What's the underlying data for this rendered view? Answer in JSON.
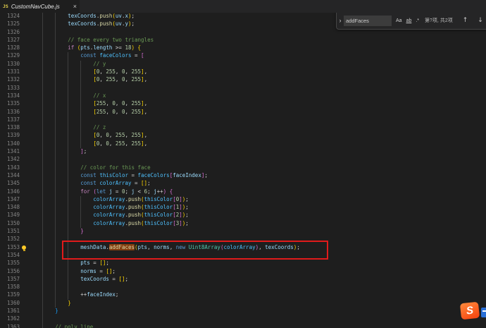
{
  "tab": {
    "icon_label": "JS",
    "filename": "CustomNavCube.js",
    "close_glyph": "×"
  },
  "find": {
    "toggle_glyph": "›",
    "query": "addFaces",
    "match_case_label": "Aa",
    "whole_word_label": "ab",
    "regex_label": ".*",
    "results": "第?项, 共2项",
    "prev_glyph": "↑",
    "next_glyph": "↓"
  },
  "watermark": {
    "letter": "S"
  },
  "colors": {
    "editor_bg": "#1e1e1e",
    "tabbar_bg": "#252526",
    "annotation_red": "#e01b1b",
    "find_match_highlight": "#ea5c00"
  },
  "editor": {
    "first_line": 1324,
    "lines": [
      {
        "n": 1324,
        "i": 12,
        "t": [
          [
            "texCoords",
            "v"
          ],
          [
            ".",
            "o"
          ],
          [
            "push",
            "f"
          ],
          [
            "(",
            "bg"
          ],
          [
            "uv",
            "v"
          ],
          [
            ".",
            "o"
          ],
          [
            "x",
            "v"
          ],
          [
            ")",
            "bg"
          ],
          [
            ";",
            "o"
          ]
        ]
      },
      {
        "n": 1325,
        "i": 12,
        "t": [
          [
            "texCoords",
            "v"
          ],
          [
            ".",
            "o"
          ],
          [
            "push",
            "f"
          ],
          [
            "(",
            "bg"
          ],
          [
            "uv",
            "v"
          ],
          [
            ".",
            "o"
          ],
          [
            "y",
            "v"
          ],
          [
            ")",
            "bg"
          ],
          [
            ";",
            "o"
          ]
        ]
      },
      {
        "n": 1326,
        "i": 0,
        "t": []
      },
      {
        "n": 1327,
        "i": 12,
        "t": [
          [
            "// face every two triangles",
            "cm"
          ]
        ]
      },
      {
        "n": 1328,
        "i": 12,
        "t": [
          [
            "if",
            "ct"
          ],
          [
            " ",
            "p"
          ],
          [
            "(",
            "bg"
          ],
          [
            "pts",
            "v"
          ],
          [
            ".",
            "o"
          ],
          [
            "length",
            "v"
          ],
          [
            " >= ",
            "o"
          ],
          [
            "18",
            "n"
          ],
          [
            ")",
            "bg"
          ],
          [
            " ",
            "p"
          ],
          [
            "{",
            "bg"
          ]
        ]
      },
      {
        "n": 1329,
        "i": 16,
        "t": [
          [
            "const",
            "k"
          ],
          [
            " ",
            "p"
          ],
          [
            "faceColors",
            "cv"
          ],
          [
            " = ",
            "o"
          ],
          [
            "[",
            "bp"
          ]
        ]
      },
      {
        "n": 1330,
        "i": 20,
        "t": [
          [
            "// y",
            "cm"
          ]
        ]
      },
      {
        "n": 1331,
        "i": 20,
        "t": [
          [
            "[",
            "bg"
          ],
          [
            "0",
            "n"
          ],
          [
            ", ",
            "o"
          ],
          [
            "255",
            "n"
          ],
          [
            ", ",
            "o"
          ],
          [
            "0",
            "n"
          ],
          [
            ", ",
            "o"
          ],
          [
            "255",
            "n"
          ],
          [
            "]",
            "bg"
          ],
          [
            ",",
            "o"
          ]
        ]
      },
      {
        "n": 1332,
        "i": 20,
        "t": [
          [
            "[",
            "bg"
          ],
          [
            "0",
            "n"
          ],
          [
            ", ",
            "o"
          ],
          [
            "255",
            "n"
          ],
          [
            ", ",
            "o"
          ],
          [
            "0",
            "n"
          ],
          [
            ", ",
            "o"
          ],
          [
            "255",
            "n"
          ],
          [
            "]",
            "bg"
          ],
          [
            ",",
            "o"
          ]
        ]
      },
      {
        "n": 1333,
        "i": 0,
        "t": []
      },
      {
        "n": 1334,
        "i": 20,
        "t": [
          [
            "// x",
            "cm"
          ]
        ]
      },
      {
        "n": 1335,
        "i": 20,
        "t": [
          [
            "[",
            "bg"
          ],
          [
            "255",
            "n"
          ],
          [
            ", ",
            "o"
          ],
          [
            "0",
            "n"
          ],
          [
            ", ",
            "o"
          ],
          [
            "0",
            "n"
          ],
          [
            ", ",
            "o"
          ],
          [
            "255",
            "n"
          ],
          [
            "]",
            "bg"
          ],
          [
            ",",
            "o"
          ]
        ]
      },
      {
        "n": 1336,
        "i": 20,
        "t": [
          [
            "[",
            "bg"
          ],
          [
            "255",
            "n"
          ],
          [
            ", ",
            "o"
          ],
          [
            "0",
            "n"
          ],
          [
            ", ",
            "o"
          ],
          [
            "0",
            "n"
          ],
          [
            ", ",
            "o"
          ],
          [
            "255",
            "n"
          ],
          [
            "]",
            "bg"
          ],
          [
            ",",
            "o"
          ]
        ]
      },
      {
        "n": 1337,
        "i": 0,
        "t": []
      },
      {
        "n": 1338,
        "i": 20,
        "t": [
          [
            "// z",
            "cm"
          ]
        ]
      },
      {
        "n": 1339,
        "i": 20,
        "t": [
          [
            "[",
            "bg"
          ],
          [
            "0",
            "n"
          ],
          [
            ", ",
            "o"
          ],
          [
            "0",
            "n"
          ],
          [
            ", ",
            "o"
          ],
          [
            "255",
            "n"
          ],
          [
            ", ",
            "o"
          ],
          [
            "255",
            "n"
          ],
          [
            "]",
            "bg"
          ],
          [
            ",",
            "o"
          ]
        ]
      },
      {
        "n": 1340,
        "i": 20,
        "t": [
          [
            "[",
            "bg"
          ],
          [
            "0",
            "n"
          ],
          [
            ", ",
            "o"
          ],
          [
            "0",
            "n"
          ],
          [
            ", ",
            "o"
          ],
          [
            "255",
            "n"
          ],
          [
            ", ",
            "o"
          ],
          [
            "255",
            "n"
          ],
          [
            "]",
            "bg"
          ],
          [
            ",",
            "o"
          ]
        ]
      },
      {
        "n": 1341,
        "i": 16,
        "t": [
          [
            "]",
            "bp"
          ],
          [
            ";",
            "o"
          ]
        ]
      },
      {
        "n": 1342,
        "i": 0,
        "t": []
      },
      {
        "n": 1343,
        "i": 16,
        "t": [
          [
            "// color for this face",
            "cm"
          ]
        ]
      },
      {
        "n": 1344,
        "i": 16,
        "t": [
          [
            "const",
            "k"
          ],
          [
            " ",
            "p"
          ],
          [
            "thisColor",
            "cv"
          ],
          [
            " = ",
            "o"
          ],
          [
            "faceColors",
            "cv"
          ],
          [
            "[",
            "bp"
          ],
          [
            "faceIndex",
            "v"
          ],
          [
            "]",
            "bp"
          ],
          [
            ";",
            "o"
          ]
        ]
      },
      {
        "n": 1345,
        "i": 16,
        "t": [
          [
            "const",
            "k"
          ],
          [
            " ",
            "p"
          ],
          [
            "colorArray",
            "cv"
          ],
          [
            " = ",
            "o"
          ],
          [
            "[]",
            "bg"
          ],
          [
            ";",
            "o"
          ]
        ]
      },
      {
        "n": 1346,
        "i": 16,
        "t": [
          [
            "for",
            "ct"
          ],
          [
            " ",
            "p"
          ],
          [
            "(",
            "bp"
          ],
          [
            "let",
            "k"
          ],
          [
            " ",
            "p"
          ],
          [
            "j",
            "v"
          ],
          [
            " = ",
            "o"
          ],
          [
            "0",
            "n"
          ],
          [
            "; ",
            "o"
          ],
          [
            "j",
            "v"
          ],
          [
            " < ",
            "o"
          ],
          [
            "6",
            "n"
          ],
          [
            "; ",
            "o"
          ],
          [
            "j",
            "v"
          ],
          [
            "++",
            "o"
          ],
          [
            ")",
            "bp"
          ],
          [
            " ",
            "p"
          ],
          [
            "{",
            "bp"
          ]
        ]
      },
      {
        "n": 1347,
        "i": 20,
        "t": [
          [
            "colorArray",
            "cv"
          ],
          [
            ".",
            "o"
          ],
          [
            "push",
            "f"
          ],
          [
            "(",
            "bg"
          ],
          [
            "thisColor",
            "cv"
          ],
          [
            "[",
            "bp"
          ],
          [
            "0",
            "n"
          ],
          [
            "]",
            "bp"
          ],
          [
            ")",
            "bg"
          ],
          [
            ";",
            "o"
          ]
        ]
      },
      {
        "n": 1348,
        "i": 20,
        "t": [
          [
            "colorArray",
            "cv"
          ],
          [
            ".",
            "o"
          ],
          [
            "push",
            "f"
          ],
          [
            "(",
            "bg"
          ],
          [
            "thisColor",
            "cv"
          ],
          [
            "[",
            "bp"
          ],
          [
            "1",
            "n"
          ],
          [
            "]",
            "bp"
          ],
          [
            ")",
            "bg"
          ],
          [
            ";",
            "o"
          ]
        ]
      },
      {
        "n": 1349,
        "i": 20,
        "t": [
          [
            "colorArray",
            "cv"
          ],
          [
            ".",
            "o"
          ],
          [
            "push",
            "f"
          ],
          [
            "(",
            "bg"
          ],
          [
            "thisColor",
            "cv"
          ],
          [
            "[",
            "bp"
          ],
          [
            "2",
            "n"
          ],
          [
            "]",
            "bp"
          ],
          [
            ")",
            "bg"
          ],
          [
            ";",
            "o"
          ]
        ]
      },
      {
        "n": 1350,
        "i": 20,
        "t": [
          [
            "colorArray",
            "cv"
          ],
          [
            ".",
            "o"
          ],
          [
            "push",
            "f"
          ],
          [
            "(",
            "bg"
          ],
          [
            "thisColor",
            "cv"
          ],
          [
            "[",
            "bp"
          ],
          [
            "3",
            "n"
          ],
          [
            "]",
            "bp"
          ],
          [
            ")",
            "bg"
          ],
          [
            ";",
            "o"
          ]
        ]
      },
      {
        "n": 1351,
        "i": 16,
        "t": [
          [
            "}",
            "bp"
          ]
        ]
      },
      {
        "n": 1352,
        "i": 0,
        "t": []
      },
      {
        "n": 1353,
        "i": 16,
        "lb": true,
        "t": [
          [
            "meshData",
            "v"
          ],
          [
            ".",
            "o"
          ],
          [
            "addFaces",
            "f",
            "hl"
          ],
          [
            "(",
            "bg"
          ],
          [
            "pts",
            "v"
          ],
          [
            ", ",
            "o"
          ],
          [
            "norms",
            "v"
          ],
          [
            ", ",
            "o"
          ],
          [
            "new",
            "k"
          ],
          [
            " ",
            "p"
          ],
          [
            "Uint8Array",
            "cl"
          ],
          [
            "(",
            "bp"
          ],
          [
            "colorArray",
            "cv"
          ],
          [
            ")",
            "bp"
          ],
          [
            ", ",
            "o"
          ],
          [
            "texCoords",
            "v"
          ],
          [
            ")",
            "bg"
          ],
          [
            ";",
            "o"
          ]
        ]
      },
      {
        "n": 1354,
        "i": 0,
        "t": []
      },
      {
        "n": 1355,
        "i": 16,
        "t": [
          [
            "pts",
            "v"
          ],
          [
            " = ",
            "o"
          ],
          [
            "[]",
            "bg"
          ],
          [
            ";",
            "o"
          ]
        ]
      },
      {
        "n": 1356,
        "i": 16,
        "t": [
          [
            "norms",
            "v"
          ],
          [
            " = ",
            "o"
          ],
          [
            "[]",
            "bg"
          ],
          [
            ";",
            "o"
          ]
        ]
      },
      {
        "n": 1357,
        "i": 16,
        "t": [
          [
            "texCoords",
            "v"
          ],
          [
            " = ",
            "o"
          ],
          [
            "[]",
            "bg"
          ],
          [
            ";",
            "o"
          ]
        ]
      },
      {
        "n": 1358,
        "i": 0,
        "t": []
      },
      {
        "n": 1359,
        "i": 16,
        "t": [
          [
            "++",
            "o"
          ],
          [
            "faceIndex",
            "v"
          ],
          [
            ";",
            "o"
          ]
        ]
      },
      {
        "n": 1360,
        "i": 12,
        "t": [
          [
            "}",
            "bg"
          ]
        ]
      },
      {
        "n": 1361,
        "i": 8,
        "t": [
          [
            "}",
            "bb"
          ]
        ]
      },
      {
        "n": 1362,
        "i": 0,
        "t": []
      },
      {
        "n": 1363,
        "i": 8,
        "t": [
          [
            "// poly line",
            "cm"
          ]
        ]
      }
    ]
  }
}
